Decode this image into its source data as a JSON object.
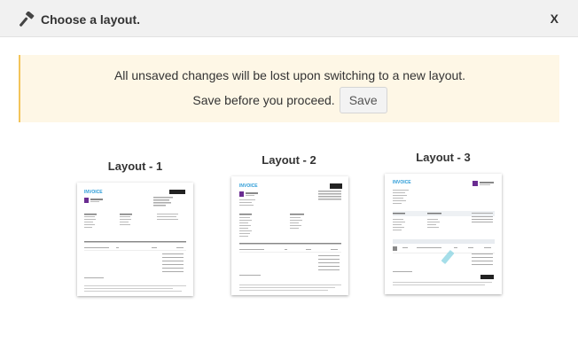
{
  "header": {
    "title": "Choose a layout.",
    "close_label": "X"
  },
  "warning": {
    "line1": "All unsaved changes will be lost upon switching to a new layout.",
    "line2": "Save before you proceed.",
    "save_label": "Save"
  },
  "layouts": [
    {
      "label": "Layout - 1",
      "thumb_title": "INVOICE"
    },
    {
      "label": "Layout - 2",
      "thumb_title": "INVOICE"
    },
    {
      "label": "Layout - 3",
      "thumb_title": "INVOICE"
    }
  ],
  "colors": {
    "header_bg": "#f1f1f1",
    "warning_bg": "#fef7e6",
    "warning_border": "#f3c45a",
    "invoice_accent": "#2a9bd7",
    "logo_accent": "#6a2c91"
  },
  "icons": {
    "title_icon": "hammer-icon"
  }
}
